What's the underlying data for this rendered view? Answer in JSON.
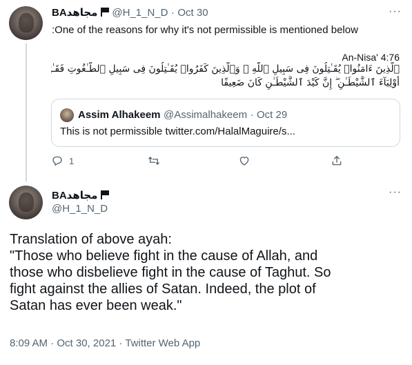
{
  "tweet1": {
    "display_name": "BAمجاهد",
    "handle": "@H_1_N_D",
    "separator": "·",
    "date": "Oct 30",
    "more_label": "···",
    "text": ":One of the reasons for why it's not permissible is mentioned below",
    "verse_ref": "An-Nisa' 4:76",
    "arabic_line1": "ٱلَّذِينَ ءَامَنُوا۟ يُقَـٰتِلُونَ فِى سَبِيلِ ٱللَّهِ ۖ وَٱلَّذِينَ كَفَرُوا۟ يُقَـٰتِلُونَ فِى سَبِيلِ ٱلطَّـٰغُوتِ فَقَـٰتِلُوٓا۟",
    "arabic_line2": "أَوْلِيَآءَ ٱلشَّيْطَـٰنِ ۖ إِنَّ كَيْدَ ٱلشَّيْطَـٰنِ كَانَ ضَعِيفًا",
    "quote": {
      "display_name": "Assim Alhakeem",
      "handle": "@Assimalhakeem",
      "separator": "·",
      "date": "Oct 29",
      "text": "This is not permissible twitter.com/HalalMaguire/s..."
    },
    "actions": {
      "reply_count": "1",
      "retweet_count": "",
      "like_count": ""
    }
  },
  "tweet2": {
    "display_name": "BAمجاهد",
    "handle": "@H_1_N_D",
    "more_label": "···",
    "text_line1": "Translation of above ayah:",
    "text_line2": "\"Those who believe fight in the cause of Allah, and",
    "text_line3": "those who disbelieve fight in the cause of Taghut. So",
    "text_line4": "fight against the allies of Satan. Indeed, the plot of",
    "text_line5": "Satan has ever been weak.\"",
    "timestamp": "8:09 AM · Oct 30, 2021 · Twitter Web App"
  }
}
